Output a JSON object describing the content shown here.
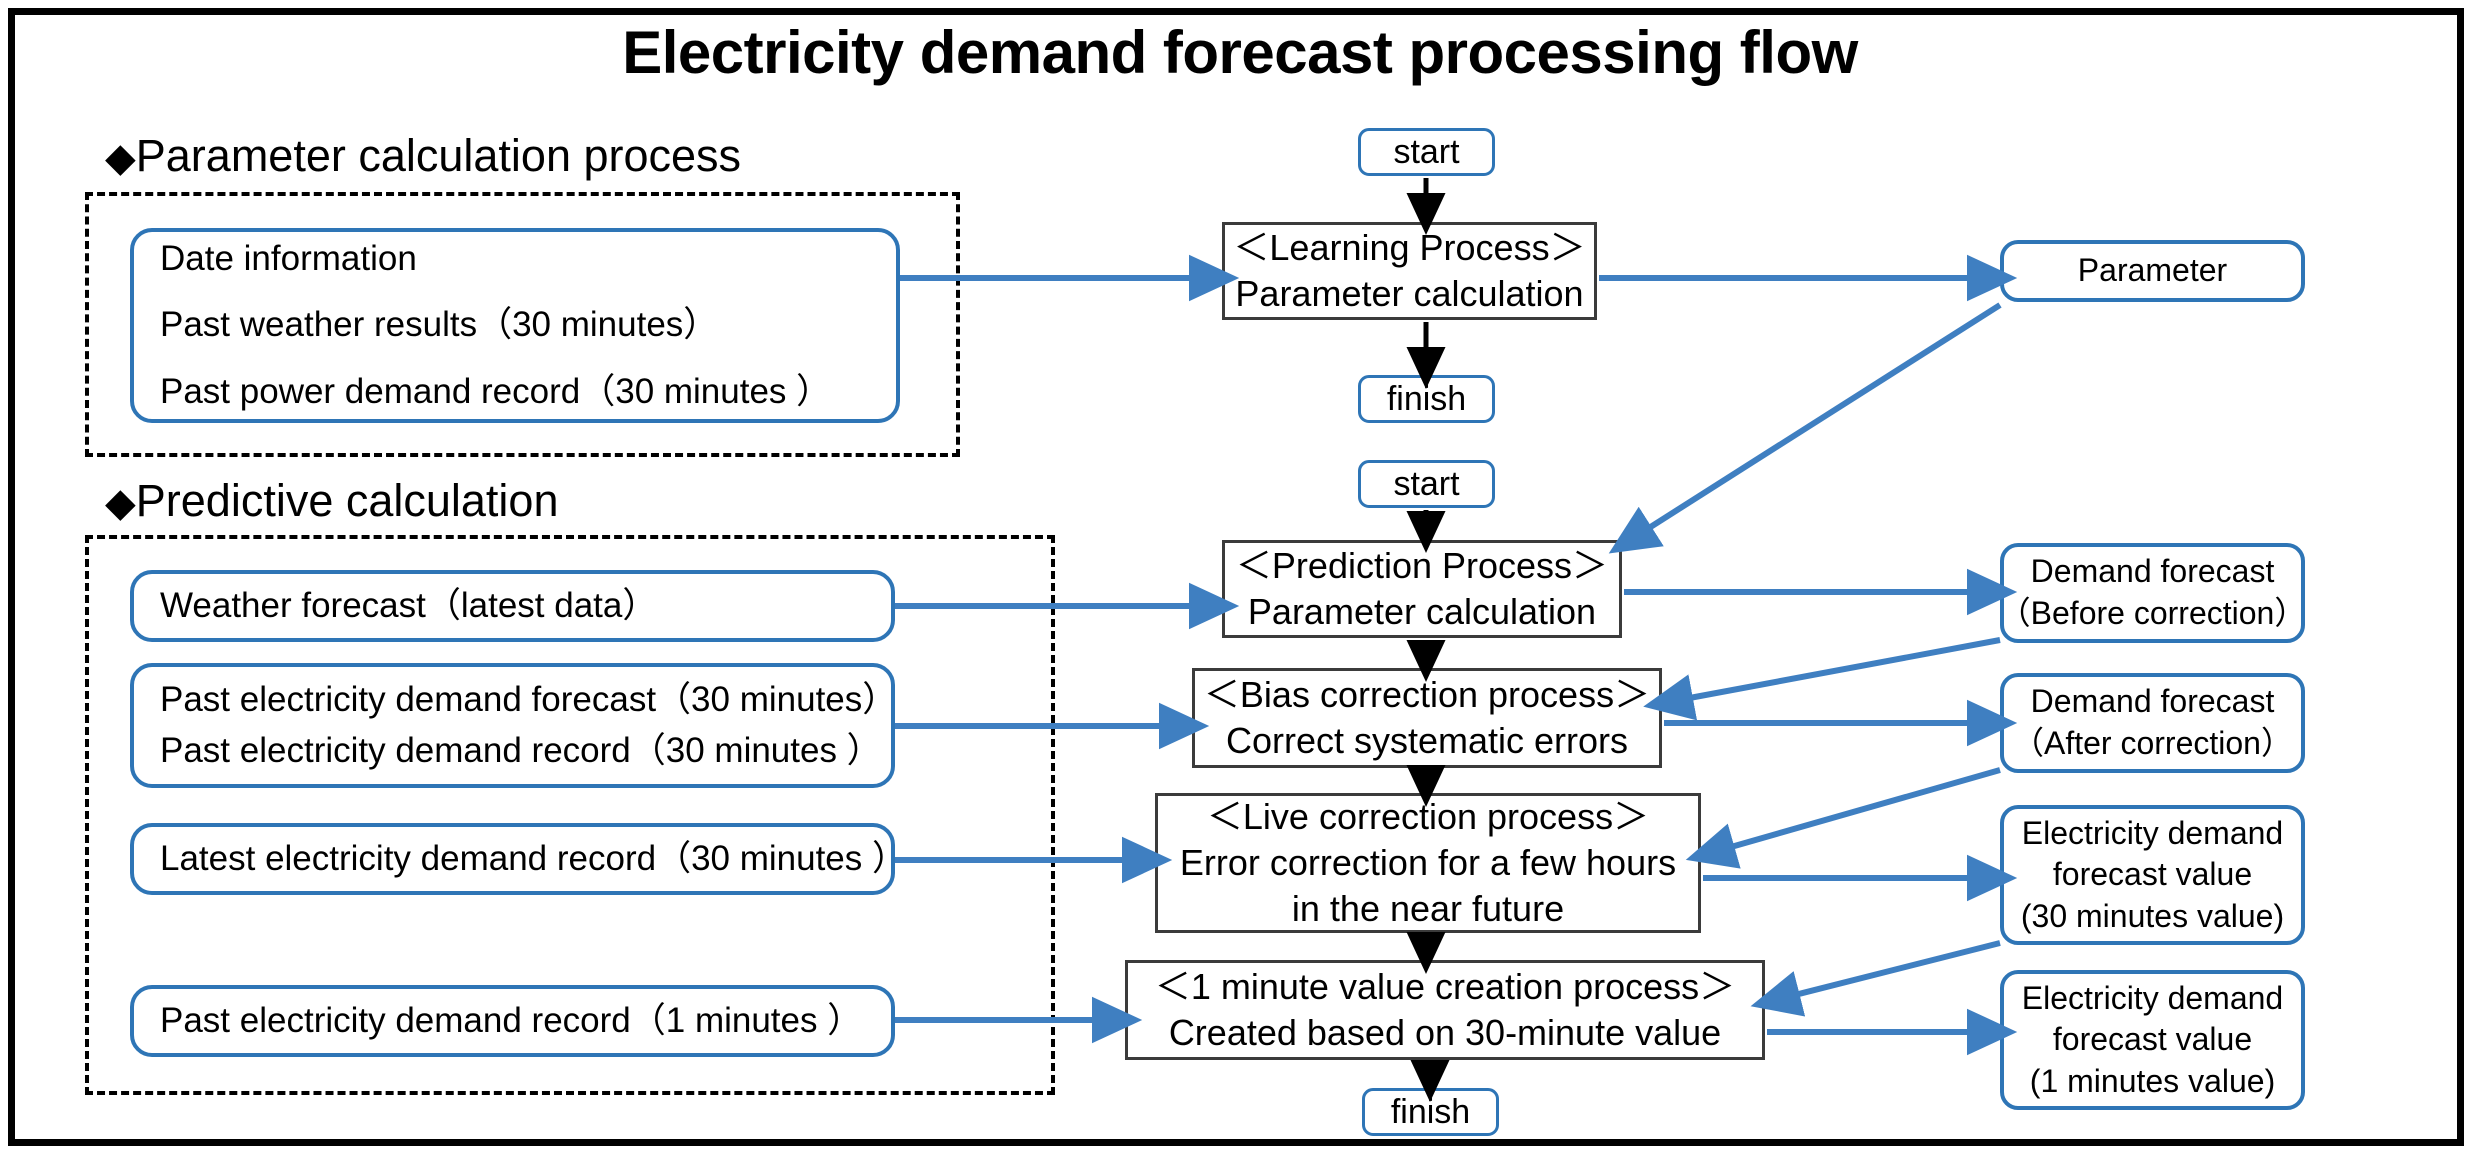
{
  "page": {
    "title": "Electricity demand forecast processing flow",
    "accent_blue": "#2E75B6",
    "arrow_blue": "#3F7FC1",
    "frame_color": "#000000"
  },
  "sections": {
    "parameter": {
      "bullet": "◆",
      "label": "Parameter calculation process"
    },
    "predictive": {
      "bullet": "◆",
      "label": "Predictive calculation"
    }
  },
  "parameter_inputs": {
    "lines": [
      "Date  information",
      "Past weather results（30 minutes）",
      "Past power demand record（30 minutes ）"
    ]
  },
  "predictive_inputs": [
    {
      "lines": [
        "Weather forecast（latest data）"
      ]
    },
    {
      "lines": [
        "Past electricity demand forecast（30 minutes）",
        "Past electricity demand record（30 minutes ）"
      ]
    },
    {
      "lines": [
        "Latest  electricity  demand record（30 minutes ）"
      ]
    },
    {
      "lines": [
        "Past  electricity  demand record（1 minutes ）"
      ]
    }
  ],
  "terminals": {
    "start_learning": "start",
    "finish_learning": "finish",
    "start_prediction": "start",
    "finish_prediction": "finish"
  },
  "processes": [
    {
      "lines": [
        "＜Learning Process＞",
        "Parameter  calculation"
      ]
    },
    {
      "lines": [
        "＜Prediction Process＞",
        "Parameter  calculation"
      ]
    },
    {
      "lines": [
        "＜Bias correction process＞",
        "Correct systematic  errors"
      ]
    },
    {
      "lines": [
        "＜Live correction process＞",
        "Error correction for a few hours",
        "in the near future"
      ]
    },
    {
      "lines": [
        "＜1 minute value creation process＞",
        "Created based on 30-minute value"
      ]
    }
  ],
  "outputs": [
    {
      "lines": [
        "Parameter"
      ]
    },
    {
      "lines": [
        "Demand forecast",
        "（Before correction）"
      ]
    },
    {
      "lines": [
        "Demand forecast",
        "（After correction）"
      ]
    },
    {
      "lines": [
        "Electricity demand",
        "forecast value",
        "(30 minutes value)"
      ]
    },
    {
      "lines": [
        "Electricity demand",
        "forecast value",
        "(1 minutes value)"
      ]
    }
  ]
}
